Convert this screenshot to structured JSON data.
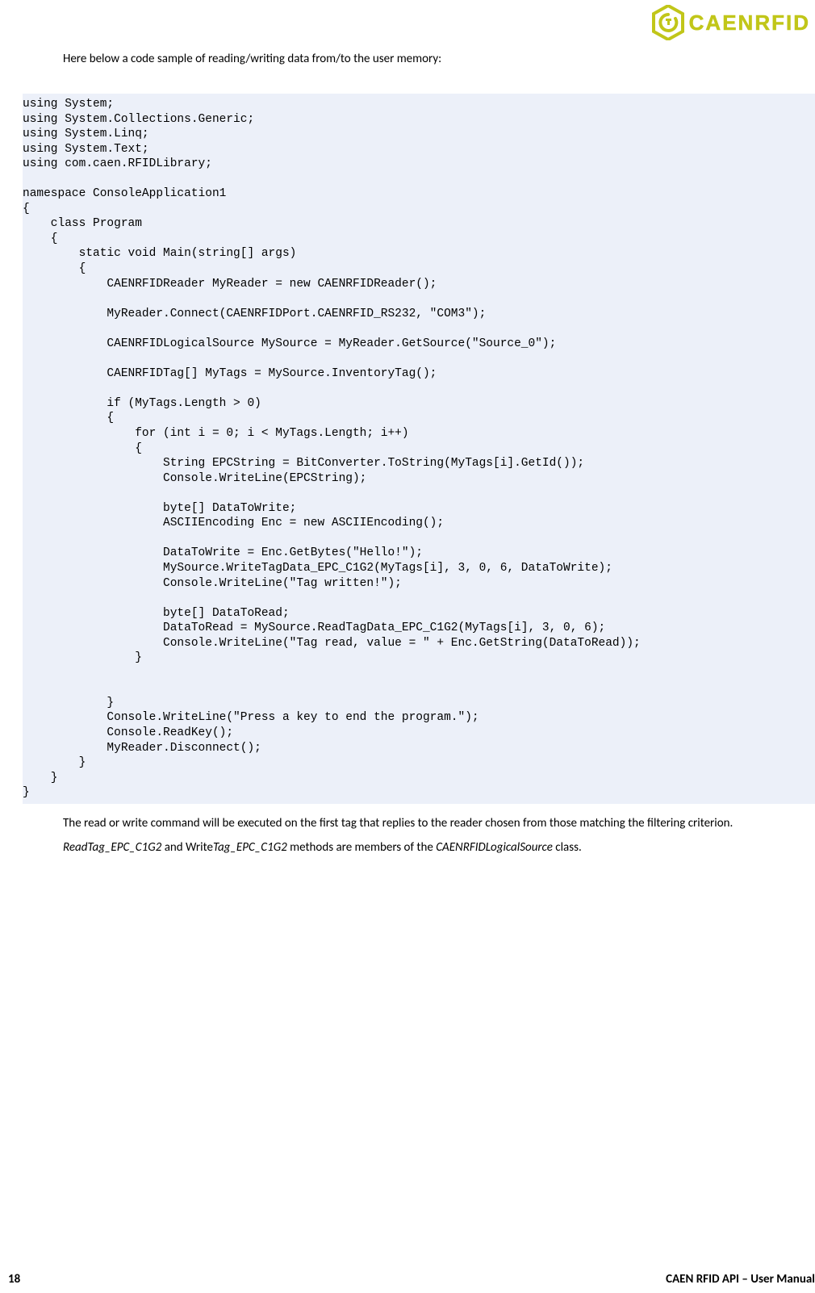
{
  "brand": {
    "name": "CAENRFID",
    "color": "#c1c619"
  },
  "intro": "Here below a code sample of reading/writing data from/to the user memory:",
  "code": "using System;\nusing System.Collections.Generic;\nusing System.Linq;\nusing System.Text;\nusing com.caen.RFIDLibrary;\n\nnamespace ConsoleApplication1\n{\n    class Program\n    {\n        static void Main(string[] args)\n        {\n            CAENRFIDReader MyReader = new CAENRFIDReader();\n\n            MyReader.Connect(CAENRFIDPort.CAENRFID_RS232, \"COM3\");\n\n            CAENRFIDLogicalSource MySource = MyReader.GetSource(\"Source_0\");\n\n            CAENRFIDTag[] MyTags = MySource.InventoryTag();\n\n            if (MyTags.Length > 0)\n            {\n                for (int i = 0; i < MyTags.Length; i++)\n                {\n                    String EPCString = BitConverter.ToString(MyTags[i].GetId());\n                    Console.WriteLine(EPCString);\n\n                    byte[] DataToWrite;\n                    ASCIIEncoding Enc = new ASCIIEncoding();\n\n                    DataToWrite = Enc.GetBytes(\"Hello!\");\n                    MySource.WriteTagData_EPC_C1G2(MyTags[i], 3, 0, 6, DataToWrite);\n                    Console.WriteLine(\"Tag written!\");\n\n                    byte[] DataToRead;\n                    DataToRead = MySource.ReadTagData_EPC_C1G2(MyTags[i], 3, 0, 6);\n                    Console.WriteLine(\"Tag read, value = \" + Enc.GetString(DataToRead));\n                }\n\n\n            }\n            Console.WriteLine(\"Press a key to end the program.\");\n            Console.ReadKey();\n            MyReader.Disconnect();\n        }\n    }\n}",
  "after": {
    "p1": "The read or write command will be executed on the first tag that replies to the reader chosen from those matching the filtering criterion.",
    "p2_a": "ReadTag_EPC_C1G2",
    "p2_b": " and Write",
    "p2_c": "Tag_EPC_C1G2",
    "p2_d": " methods are members of the ",
    "p2_e": "CAENRFIDLogicalSource",
    "p2_f": " class."
  },
  "footer": {
    "page": "18",
    "title": "CAEN RFID API – User Manual"
  }
}
